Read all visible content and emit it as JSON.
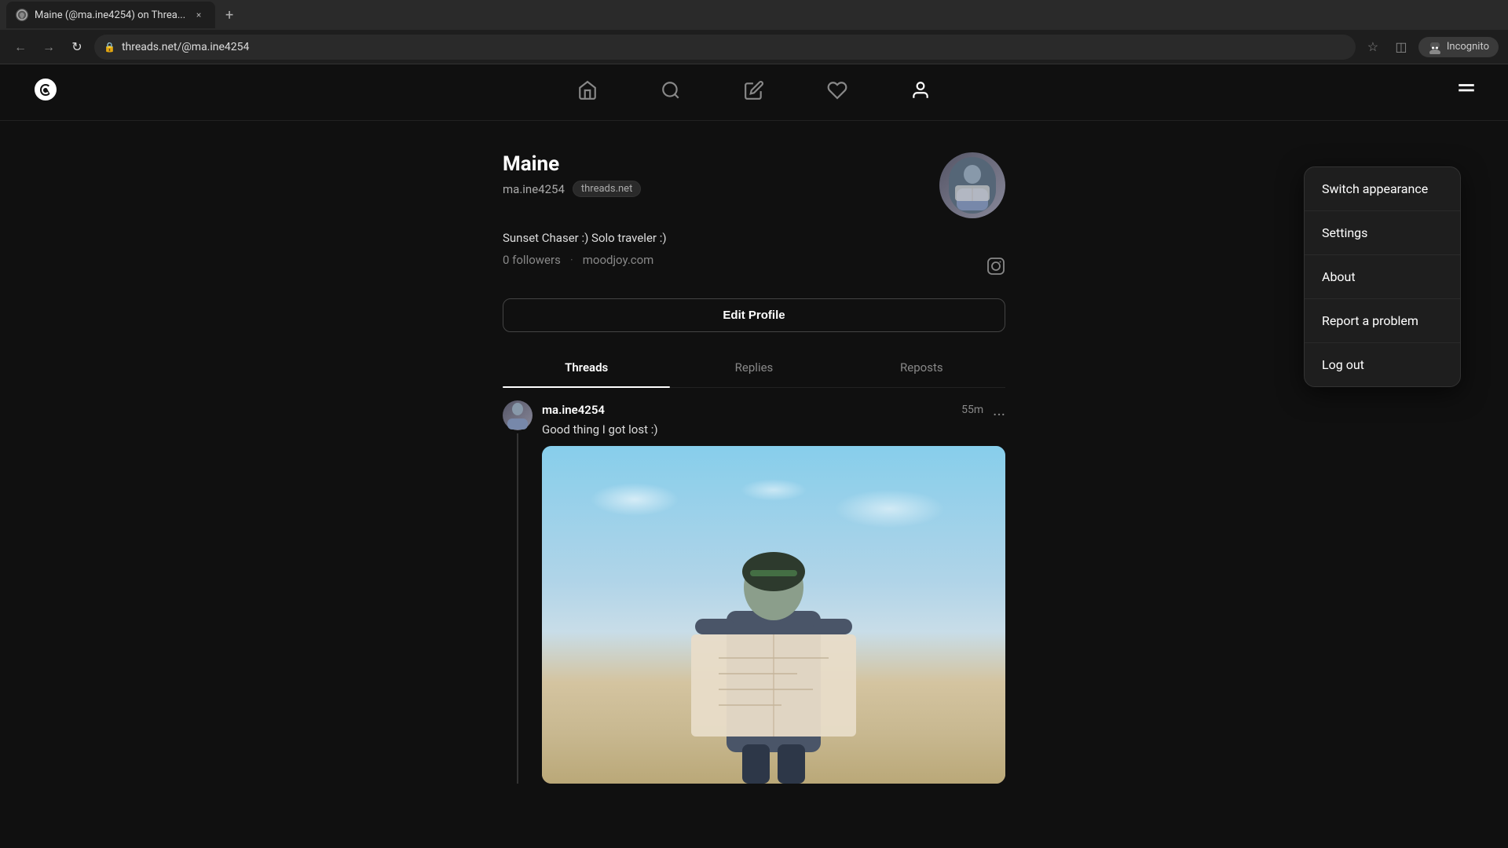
{
  "browser": {
    "tab": {
      "title": "Maine (@ma.ine4254) on Threa...",
      "favicon": "🅣",
      "close": "×"
    },
    "new_tab": "+",
    "toolbar": {
      "back": "←",
      "forward": "→",
      "refresh": "↻",
      "url": "threads.net/@ma.ine4254",
      "star": "☆",
      "extensions": "◫",
      "incognito_label": "Incognito"
    }
  },
  "nav": {
    "logo": "@",
    "icons": [
      "home",
      "search",
      "compose",
      "heart",
      "profile"
    ],
    "menu": "≡"
  },
  "profile": {
    "name": "Maine",
    "handle": "ma.ine4254",
    "badge": "threads.net",
    "bio": "Sunset Chaser :) Solo traveler :)",
    "followers": "0 followers",
    "website": "moodjoy.com",
    "edit_button": "Edit Profile",
    "tabs": [
      "Threads",
      "Replies",
      "Reposts"
    ]
  },
  "post": {
    "username": "ma.ine4254",
    "time": "55m",
    "text": "Good thing I got lost :)",
    "more": "..."
  },
  "dropdown": {
    "items": [
      {
        "label": "Switch appearance"
      },
      {
        "label": "Settings"
      },
      {
        "label": "About"
      },
      {
        "label": "Report a problem"
      },
      {
        "label": "Log out"
      }
    ]
  },
  "colors": {
    "accent": "#ffffff",
    "bg": "#101010",
    "border": "#222222",
    "muted": "#888888"
  }
}
